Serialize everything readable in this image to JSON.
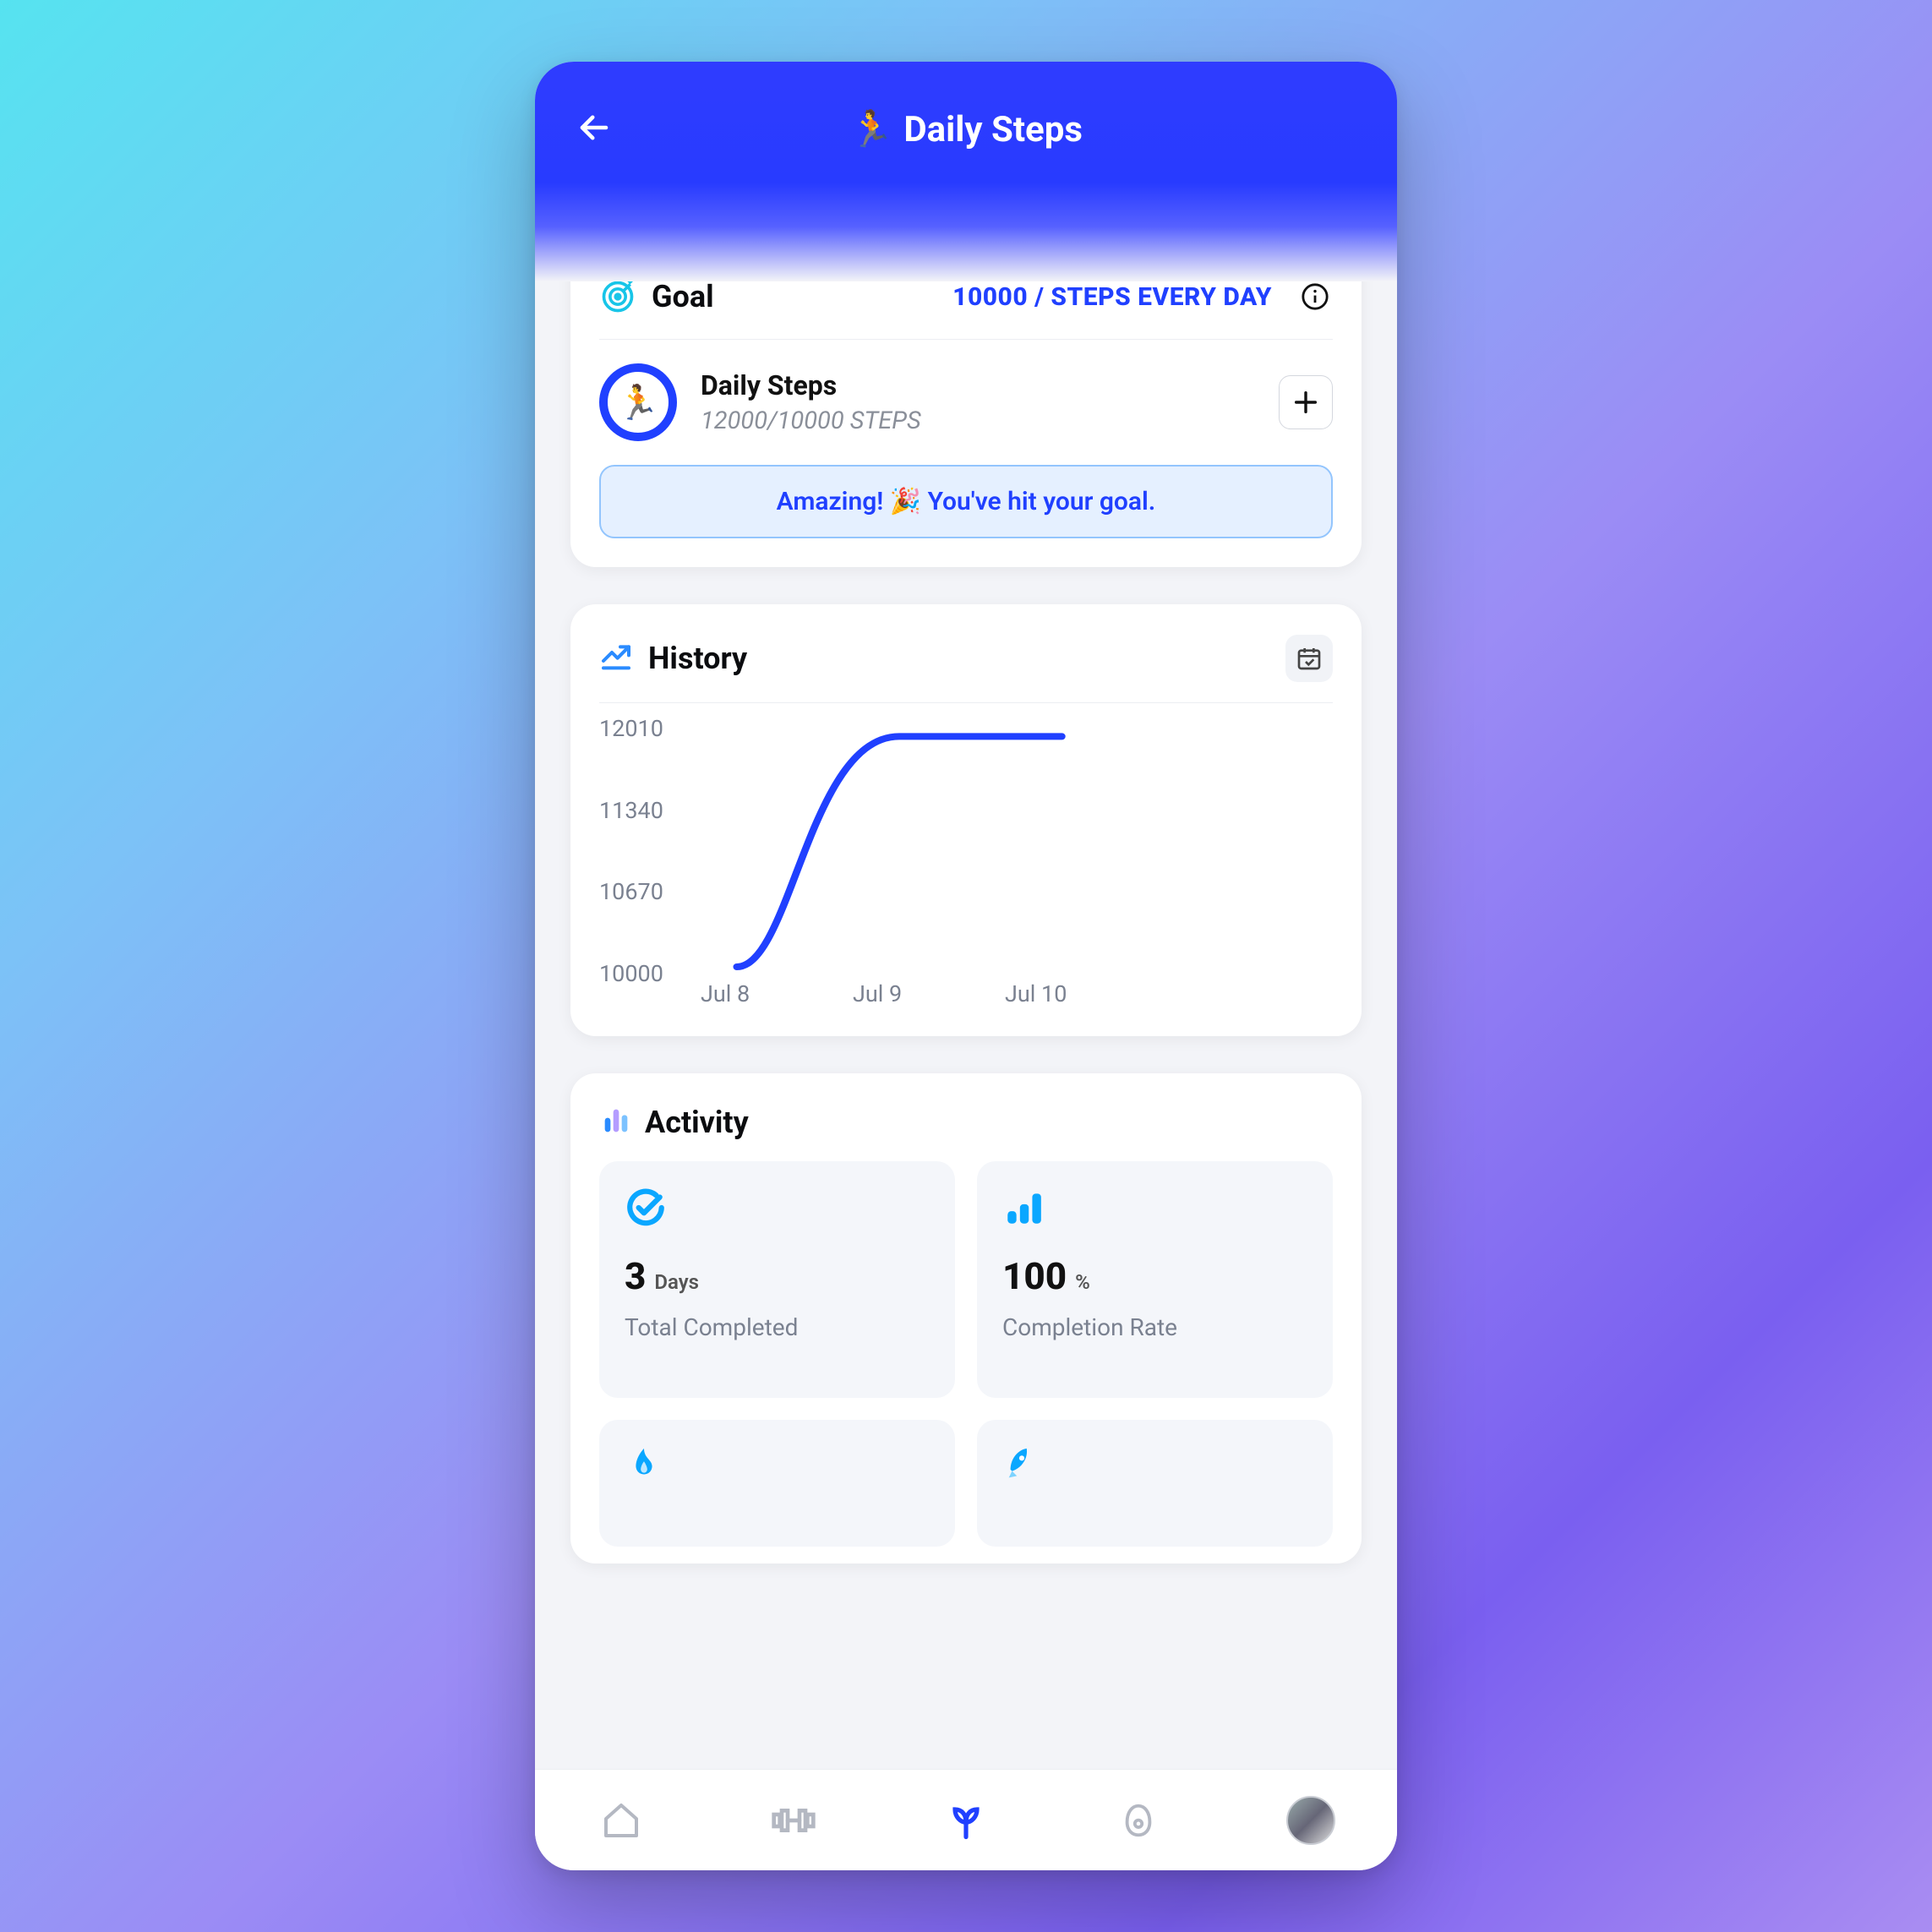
{
  "header": {
    "title": "Daily Steps",
    "emoji": "🏃"
  },
  "goal": {
    "section_title": "Goal",
    "target_text": "10000 / STEPS EVERY DAY",
    "item_name": "Daily Steps",
    "progress_text": "12000/10000 STEPS",
    "ring_emoji": "🏃",
    "banner": "Amazing! 🎉 You've hit your goal."
  },
  "history": {
    "section_title": "History"
  },
  "chart_data": {
    "type": "line",
    "title": "",
    "xlabel": "",
    "ylabel": "",
    "ylim": [
      10000,
      12010
    ],
    "y_ticks": [
      12010,
      11340,
      10670,
      10000
    ],
    "categories": [
      "Jul 8",
      "Jul 9",
      "Jul 10"
    ],
    "values": [
      10000,
      12000,
      12000
    ]
  },
  "activity": {
    "section_title": "Activity",
    "tiles": [
      {
        "value": "3",
        "unit": "Days",
        "label": "Total Completed"
      },
      {
        "value": "100",
        "unit": "%",
        "label": "Completion Rate"
      }
    ]
  },
  "colors": {
    "accent": "#2040ff",
    "cyan": "#00b4ff"
  }
}
